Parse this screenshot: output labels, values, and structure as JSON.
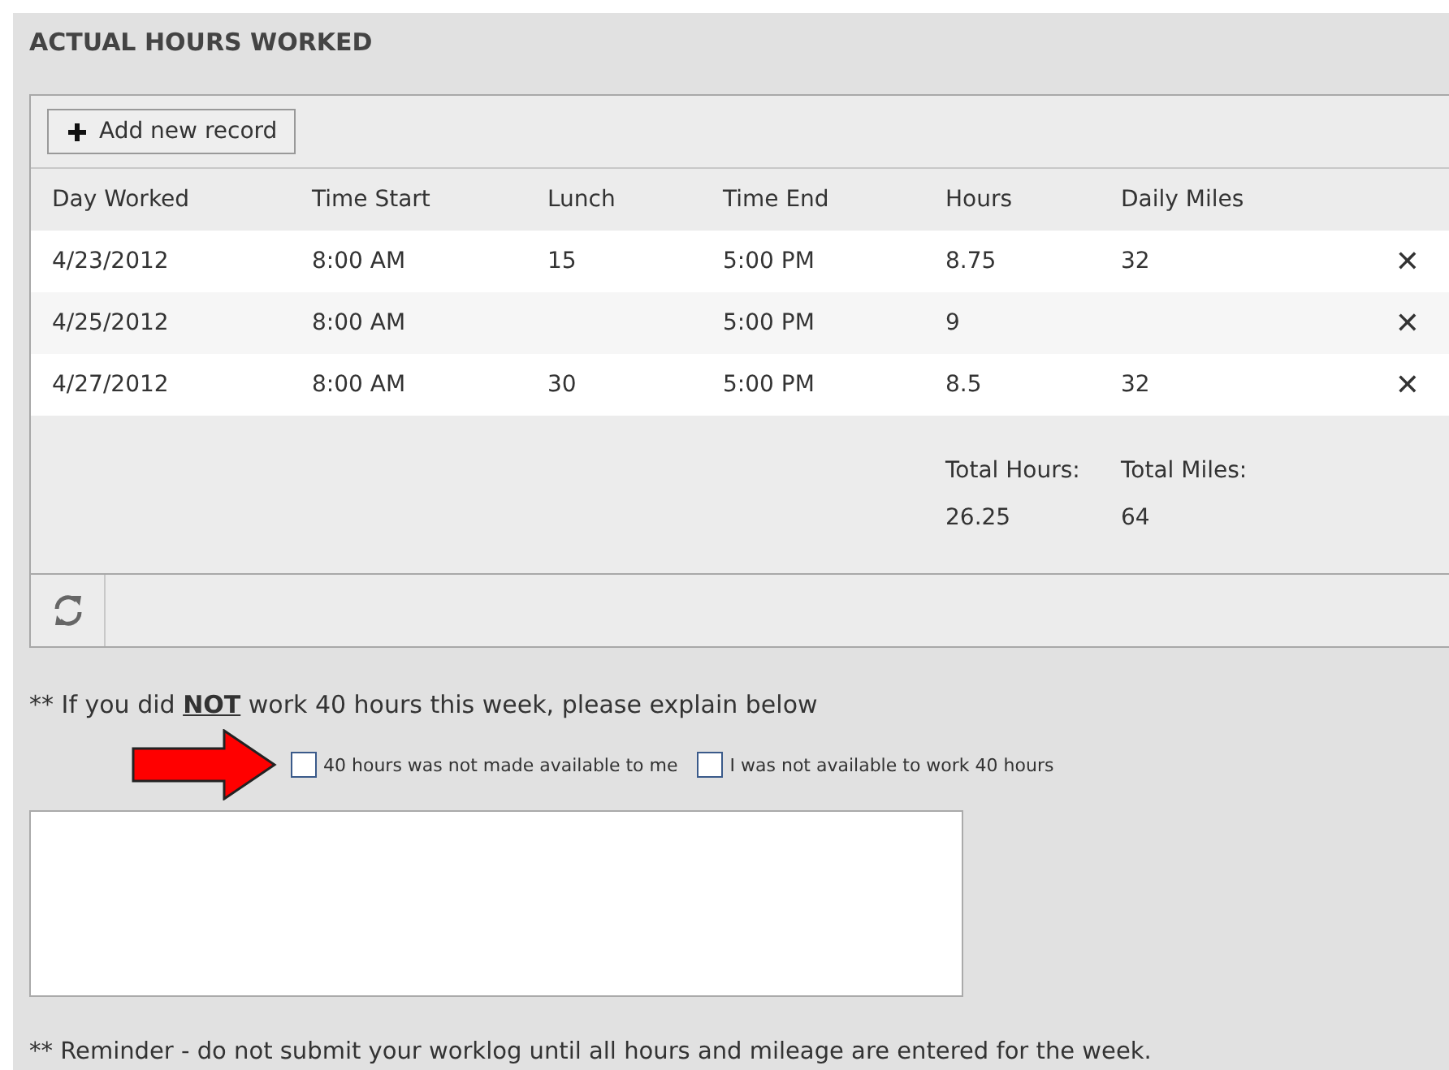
{
  "section_title": "ACTUAL HOURS WORKED",
  "toolbar": {
    "add_label": "Add new record"
  },
  "table": {
    "columns": [
      "Day Worked",
      "Time Start",
      "Lunch",
      "Time End",
      "Hours",
      "Daily Miles"
    ],
    "rows": [
      {
        "cells": [
          "4/23/2012",
          "8:00 AM",
          "15",
          "5:00 PM",
          "8.75",
          "32"
        ],
        "delete": "✕"
      },
      {
        "cells": [
          "4/25/2012",
          "8:00 AM",
          "",
          "5:00 PM",
          "9",
          ""
        ],
        "delete": "✕"
      },
      {
        "cells": [
          "4/27/2012",
          "8:00 AM",
          "30",
          "5:00 PM",
          "8.5",
          "32"
        ],
        "delete": "✕"
      }
    ],
    "footer": {
      "hours_label": "Total Hours:",
      "hours_value": "26.25",
      "miles_label": "Total Miles:",
      "miles_value": "64"
    }
  },
  "note": {
    "prefix": "** If you did ",
    "emphasis": "NOT",
    "suffix": " work 40 hours this week, please explain below"
  },
  "reasons": [
    {
      "label": "40 hours was not made available to me",
      "checked": false
    },
    {
      "label": "I was not available to work 40 hours",
      "checked": false
    }
  ],
  "reminder": "** Reminder - do not submit your worklog until all hours and mileage are entered for the week."
}
